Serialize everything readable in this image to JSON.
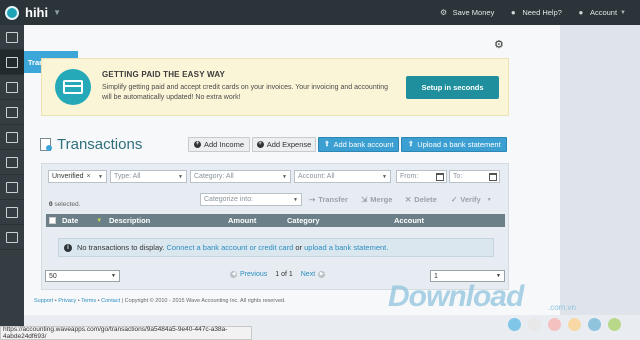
{
  "topbar": {
    "brand": "hihi",
    "save_money": "Save Money",
    "need_help": "Need Help?",
    "account": "Account"
  },
  "sidebar": {
    "flyout_label": "Transactions",
    "items": [
      "dashboard",
      "transactions",
      "invoices",
      "bills",
      "reports",
      "payroll",
      "accounting",
      "receipts",
      "customers"
    ]
  },
  "promo": {
    "title": "GETTING PAID THE EASY WAY",
    "text": "Simplify getting paid and accept credit cards on your invoices. Your invoicing and accounting will be automatically updated! No extra work!",
    "button": "Setup in seconds"
  },
  "page": {
    "title": "Transactions",
    "add_income": "Add Income",
    "add_expense": "Add Expense",
    "add_bank_account": "Add bank account",
    "upload_statement": "Upload a bank statement"
  },
  "filters": {
    "status": "Unverified",
    "type": "Type: All",
    "category": "Category: All",
    "account": "Account: All",
    "from": "From:",
    "to": "To:",
    "categorize": "Categorize into:"
  },
  "actions": {
    "selected_count": "0",
    "selected_suffix": "selected.",
    "transfer": "Transfer",
    "merge": "Merge",
    "delete": "Delete",
    "verify": "Verify"
  },
  "table": {
    "columns": [
      "Date",
      "Description",
      "Amount",
      "Category",
      "Account"
    ],
    "empty_text": "No transactions to display.",
    "connect_link": "Connect a bank account or credit card",
    "or": "or",
    "upload_link": "upload a bank statement."
  },
  "pagination": {
    "per_page": "50",
    "previous": "Previous",
    "page_info": "1 of 1",
    "next": "Next",
    "page_select": "1"
  },
  "footer": {
    "support": "Support",
    "privacy": "Privacy",
    "terms": "Terms",
    "contact": "Contact",
    "copyright": "Copyright © 2010 - 2015 Wave Accounting Inc. All rights reserved."
  },
  "status_url": "https://accounting.waveapps.com/go/transactions/9a5484a5-9e40-447c-a38a-4abde24df693/",
  "watermark": {
    "text": "Download",
    "sub": ".com.vn"
  },
  "colors": {
    "accent": "#3da6d9",
    "teal": "#1f8f9e",
    "promo_bg": "#fbf5d8",
    "dots": [
      "#7fc6e8",
      "#e8e8e8",
      "#f4c0c0",
      "#f8d9a5",
      "#8fc3de",
      "#b9d88a"
    ]
  }
}
